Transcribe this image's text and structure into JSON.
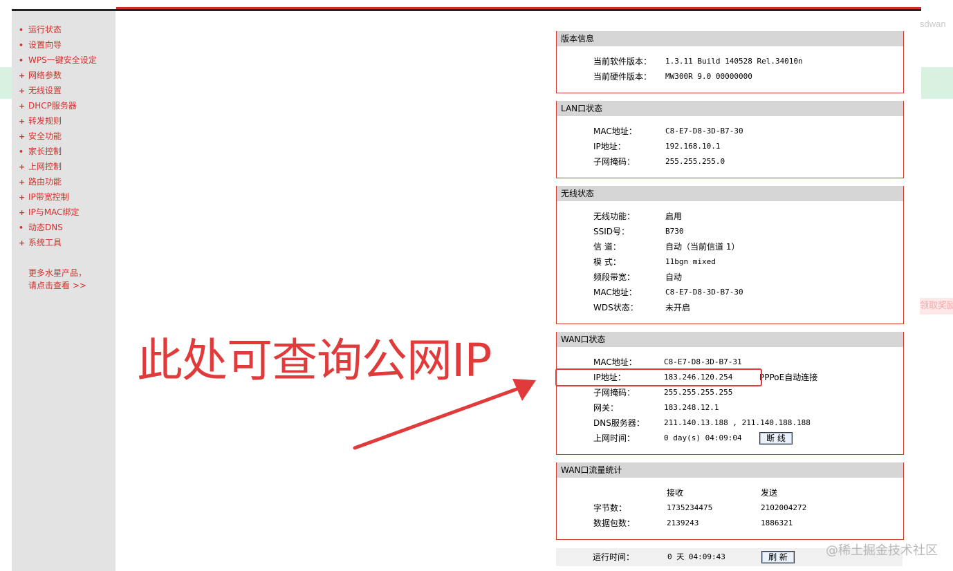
{
  "background": {
    "top_right_text": "sdwan",
    "right_badge_text": "领取奖励"
  },
  "sidebar": {
    "items": [
      {
        "label": "运行状态",
        "bullet": "•"
      },
      {
        "label": "设置向导",
        "bullet": "•"
      },
      {
        "label": "WPS一键安全设定",
        "bullet": "•"
      },
      {
        "label": "网络参数",
        "bullet": "+"
      },
      {
        "label": "无线设置",
        "bullet": "+"
      },
      {
        "label": "DHCP服务器",
        "bullet": "+"
      },
      {
        "label": "转发规则",
        "bullet": "+"
      },
      {
        "label": "安全功能",
        "bullet": "+"
      },
      {
        "label": "家长控制",
        "bullet": "•"
      },
      {
        "label": "上网控制",
        "bullet": "+"
      },
      {
        "label": "路由功能",
        "bullet": "+"
      },
      {
        "label": "IP带宽控制",
        "bullet": "+"
      },
      {
        "label": "IP与MAC绑定",
        "bullet": "+"
      },
      {
        "label": "动态DNS",
        "bullet": "•"
      },
      {
        "label": "系统工具",
        "bullet": "+"
      }
    ],
    "more_line1": "更多水星产品，",
    "more_line2": "请点击查看 >>"
  },
  "version": {
    "title": "版本信息",
    "sw_label": "当前软件版本：",
    "sw_value": "1.3.11 Build 140528 Rel.34010n",
    "hw_label": "当前硬件版本：",
    "hw_value": "MW300R 9.0 00000000"
  },
  "lan": {
    "title": "LAN口状态",
    "mac_label": "MAC地址：",
    "mac_value": "C8-E7-D8-3D-B7-30",
    "ip_label": "IP地址：",
    "ip_value": "192.168.10.1",
    "mask_label": "子网掩码：",
    "mask_value": "255.255.255.0"
  },
  "wireless": {
    "title": "无线状态",
    "func_label": "无线功能：",
    "func_value": "启用",
    "ssid_label": "SSID号：",
    "ssid_value": "B730",
    "channel_label": "信 道：",
    "channel_value": "自动（当前信道 1）",
    "mode_label": "模 式：",
    "mode_value": "11bgn mixed",
    "bw_label": "频段带宽：",
    "bw_value": "自动",
    "mac_label": "MAC地址：",
    "mac_value": "C8-E7-D8-3D-B7-30",
    "wds_label": "WDS状态：",
    "wds_value": "未开启"
  },
  "wan": {
    "title": "WAN口状态",
    "mac_label": "MAC地址：",
    "mac_value": "C8-E7-D8-3D-B7-31",
    "ip_label": "IP地址：",
    "ip_value": "183.246.120.254",
    "ip_type": "PPPoE自动连接",
    "mask_label": "子网掩码：",
    "mask_value": "255.255.255.255",
    "gw_label": "网关：",
    "gw_value": "183.248.12.1",
    "dns_label": "DNS服务器：",
    "dns_value": "211.140.13.188 , 211.140.188.188",
    "uptime_label": "上网时间：",
    "uptime_value": "0 day(s) 04:09:04",
    "disconnect_button": "断 线"
  },
  "traffic": {
    "title": "WAN口流量统计",
    "recv_header": "接收",
    "send_header": "发送",
    "bytes_label": "字节数：",
    "bytes_recv": "1735234475",
    "bytes_send": "2102004272",
    "packets_label": "数据包数：",
    "packets_recv": "2139243",
    "packets_send": "1886321"
  },
  "runtime": {
    "label": "运行时间：",
    "value": "0 天 04:09:43",
    "refresh_button": "刷 新"
  },
  "annotation": {
    "text": "此处可查询公网IP"
  },
  "watermark": "@稀土掘金技术社区",
  "colors": {
    "accent_red": "#d43b37",
    "annotation_red": "#e03a3a",
    "header_gray": "#d5d5d5",
    "sidebar_gray": "#e3e3e3"
  }
}
